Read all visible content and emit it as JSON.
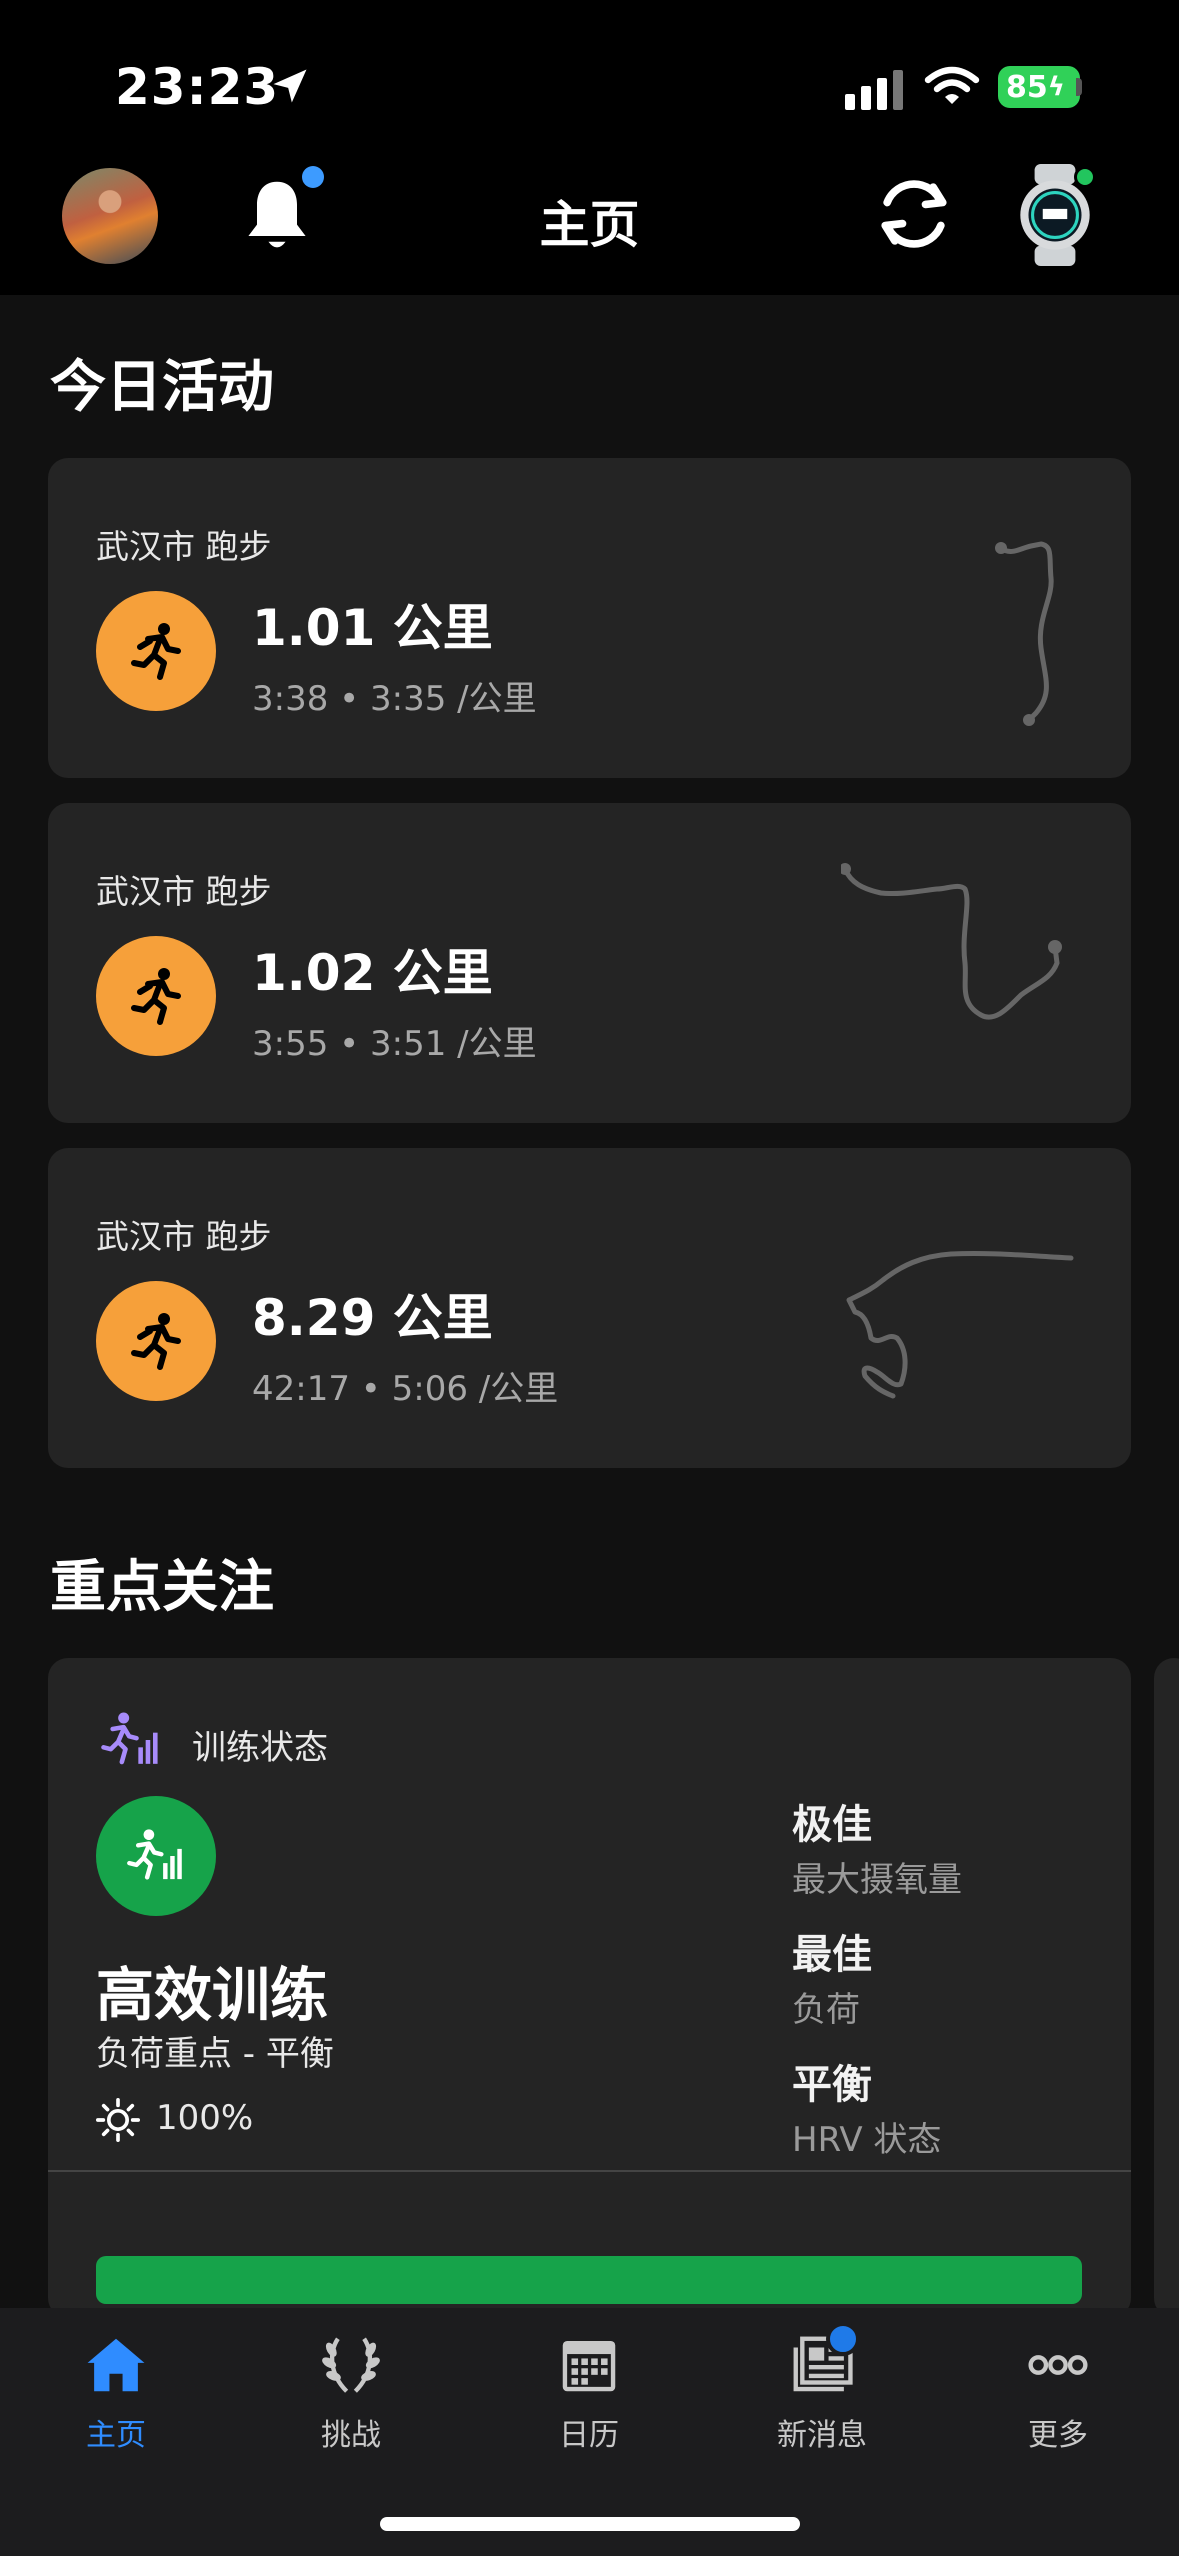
{
  "status_bar": {
    "time": "23:23",
    "battery": "85"
  },
  "header": {
    "title": "主页"
  },
  "today": {
    "section_title": "今日活动",
    "activities": [
      {
        "location": "武汉市 跑步",
        "distance": "1.01 公里",
        "stats": "3:38 • 3:35 /公里"
      },
      {
        "location": "武汉市 跑步",
        "distance": "1.02 公里",
        "stats": "3:55 • 3:51 /公里"
      },
      {
        "location": "武汉市 跑步",
        "distance": "8.29 公里",
        "stats": "42:17 • 5:06 /公里"
      }
    ]
  },
  "focus": {
    "section_title": "重点关注",
    "training": {
      "label": "训练状态",
      "status": "高效训练",
      "load_focus": "负荷重点 - 平衡",
      "percent": "100%",
      "metrics": [
        {
          "value": "极佳",
          "label": "最大摄氧量"
        },
        {
          "value": "最佳",
          "label": "负荷"
        },
        {
          "value": "平衡",
          "label": "HRV 状态"
        }
      ]
    }
  },
  "tabs": [
    {
      "label": "主页",
      "icon": "home-icon",
      "active": true
    },
    {
      "label": "挑战",
      "icon": "laurel-icon"
    },
    {
      "label": "日历",
      "icon": "calendar-icon"
    },
    {
      "label": "新消息",
      "icon": "news-icon"
    },
    {
      "label": "更多",
      "icon": "more-icon"
    }
  ],
  "colors": {
    "accent": "#2f8cff",
    "run_orange": "#f6a03a",
    "training_green": "#16a34a",
    "card_bg": "#242424",
    "route_gray": "#666666"
  }
}
